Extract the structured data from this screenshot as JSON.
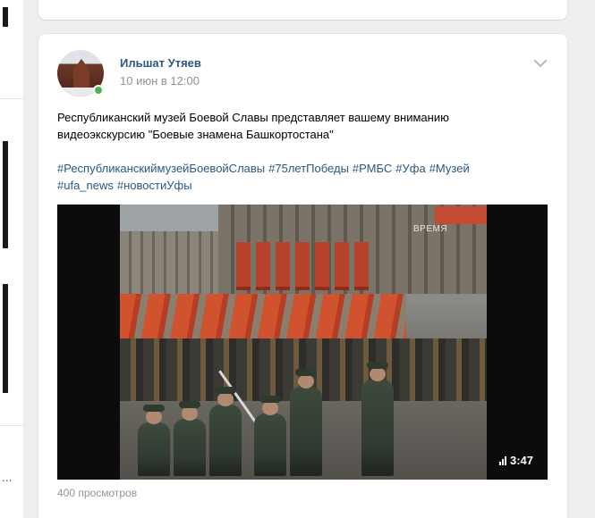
{
  "sidebar": {
    "more_label": "..."
  },
  "post": {
    "author": "Ильшат Утяев",
    "date": "10 июн в 12:00",
    "text_lines": [
      "Республиканский музей Боевой Славы представляет вашему вниманию",
      "видеоэкскурсию \"Боевые знамена Башкортостана\""
    ],
    "hashtags": [
      "#РеспубликанскиймузейБоевойСлавы",
      "#75летПобеды",
      "#РМБС",
      "#Уфа",
      "#Музей",
      "#ufa_news",
      "#новостиУфы"
    ],
    "video": {
      "watermark": "ВРЕМЯ",
      "duration": "3:47"
    },
    "views": "400 просмотров"
  },
  "colors": {
    "link": "#2a5885",
    "muted": "#939393",
    "online": "#4bb34b",
    "page_bg": "#edeef0"
  },
  "icons": [
    "chevron-down-icon",
    "quality-bars-icon",
    "online-indicator"
  ]
}
